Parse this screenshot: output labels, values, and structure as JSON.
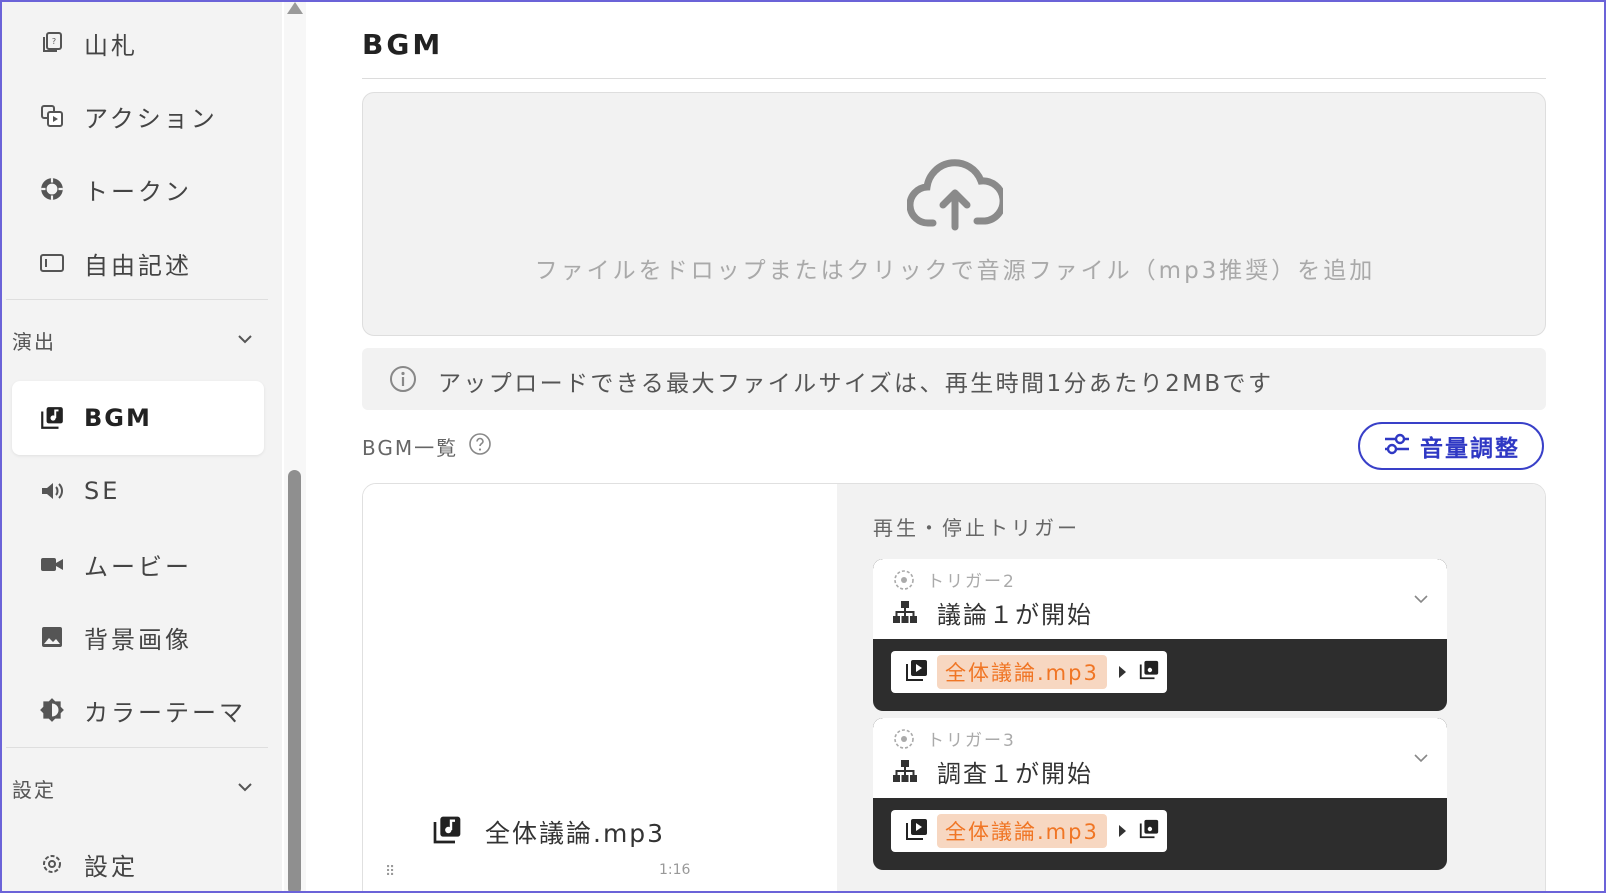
{
  "sidebar": {
    "items_top": [
      {
        "label": "山札",
        "icon": "deck-icon"
      },
      {
        "label": "アクション",
        "icon": "action-icon"
      },
      {
        "label": "トークン",
        "icon": "token-icon"
      },
      {
        "label": "自由記述",
        "icon": "free-text-icon"
      }
    ],
    "section_staging": "演出",
    "items_staging": [
      {
        "label": "BGM",
        "icon": "music-library-icon",
        "active": true
      },
      {
        "label": "SE",
        "icon": "speaker-icon"
      },
      {
        "label": "ムービー",
        "icon": "video-camera-icon"
      },
      {
        "label": "背景画像",
        "icon": "image-icon"
      },
      {
        "label": "カラーテーマ",
        "icon": "theme-icon"
      }
    ],
    "section_settings": "設定",
    "items_settings": [
      {
        "label": "設定",
        "icon": "gear-icon"
      }
    ]
  },
  "main": {
    "title": "BGM",
    "dropzone_text": "ファイルをドロップまたはクリックで音源ファイル（mp3推奨）を追加",
    "notice": "アップロードできる最大ファイルサイズは、再生時間1分あたり2MBです",
    "list_title": "BGM一覧",
    "volume_button": "音量調整",
    "track": {
      "name": "全体議論.mp3",
      "duration": "1:16",
      "drag": "⠿"
    },
    "trigger_section_label": "再生・停止トリガー",
    "triggers": [
      {
        "small": "トリガー2",
        "title": "議論１が開始",
        "file": "全体議論.mp3"
      },
      {
        "small": "トリガー3",
        "title": "調査１が開始",
        "file": "全体議論.mp3"
      }
    ]
  },
  "colors": {
    "accent": "#3940c8",
    "pill_bg": "#f7d7c1",
    "pill_text": "#f07524",
    "frame": "#6b63d8"
  }
}
